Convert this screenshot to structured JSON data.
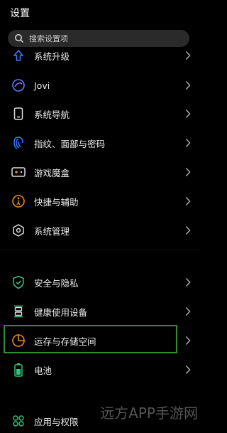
{
  "header": {
    "title": "设置"
  },
  "search": {
    "placeholder": "搜索设置项"
  },
  "items": [
    {
      "label": "系统升级",
      "icon": "upgrade-arrow-icon"
    },
    {
      "label": "Jovi",
      "icon": "jovi-icon"
    },
    {
      "label": "系统导航",
      "icon": "phone-navigation-icon"
    },
    {
      "label": "指纹、面部与密码",
      "icon": "fingerprint-icon"
    },
    {
      "label": "游戏魔盒",
      "icon": "game-box-icon"
    },
    {
      "label": "快捷与辅助",
      "icon": "accessibility-icon"
    },
    {
      "label": "系统管理",
      "icon": "system-manage-icon"
    },
    {
      "label": "安全与隐私",
      "icon": "shield-check-icon"
    },
    {
      "label": "健康使用设备",
      "icon": "hourglass-icon"
    },
    {
      "label": "运存与存储空间",
      "icon": "storage-pie-icon"
    },
    {
      "label": "电池",
      "icon": "battery-icon"
    },
    {
      "label": "应用与权限",
      "icon": "apps-icon"
    }
  ],
  "colors": {
    "accent": "#3a7bff",
    "orange": "#f08a2a",
    "green": "#35c27a",
    "highlight": "#2f8f2f"
  },
  "watermark": "远方APP手游网"
}
